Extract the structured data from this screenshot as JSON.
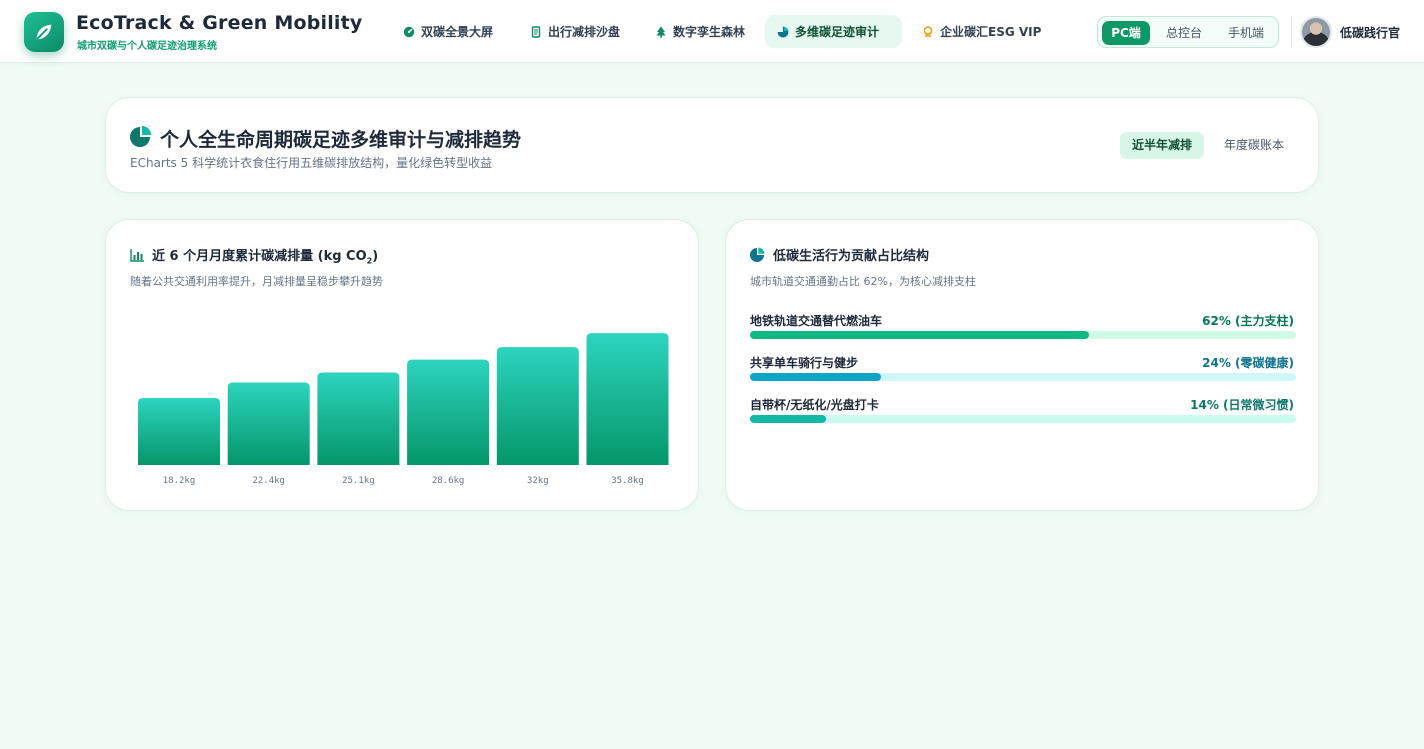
{
  "brand": {
    "title": "EcoTrack & Green Mobility",
    "subtitle": "城市双碳与个人碳足迹治理系统",
    "logo_icon": "leaf-icon"
  },
  "nav": [
    {
      "label": "双碳全景大屏",
      "icon": "dashboard-icon",
      "active": false
    },
    {
      "label": "出行减排沙盘",
      "icon": "document-icon",
      "active": false
    },
    {
      "label": "数字孪生森林",
      "icon": "tree-icon",
      "active": false
    },
    {
      "label": "多维碳足迹审计",
      "icon": "pie-chart-icon",
      "active": true
    },
    {
      "label": "企业碳汇ESG VIP",
      "icon": "medal-icon",
      "active": false
    }
  ],
  "mode_switch": {
    "options": [
      "PC端",
      "总控台",
      "手机端"
    ],
    "selected": "PC端"
  },
  "user": {
    "name": "低碳践行官",
    "avatar": "user-avatar"
  },
  "hero": {
    "title": "个人全生命周期碳足迹多维审计与减排趋势",
    "subtitle": "ECharts 5 科学统计衣食住行用五维碳排放结构，量化绿色转型收益",
    "icon": "pie-chart-icon",
    "tabs": [
      "近半年减排",
      "年度碳账本"
    ],
    "active_tab": "近半年减排"
  },
  "monthly": {
    "title_prefix": "近 6 个月月度累计碳减排量 (kg CO",
    "title_sub": "2",
    "title_suffix": ")",
    "subtitle": "随着公共交通利用率提升，月减排量呈稳步攀升趋势",
    "icon": "bar-chart-icon"
  },
  "chart_data": {
    "type": "bar",
    "categories": [
      "18.2kg",
      "22.4kg",
      "25.1kg",
      "28.6kg",
      "32kg",
      "35.8kg"
    ],
    "values": [
      18.2,
      22.4,
      25.1,
      28.6,
      32,
      35.8
    ],
    "title": "近 6 个月月度累计碳减排量 (kg CO₂)",
    "xlabel": "",
    "ylabel": "",
    "grid": false,
    "colors": {
      "top": "#2dd4bf",
      "bottom": "#059669"
    }
  },
  "mix": {
    "title": "低碳生活行为贡献占比结构",
    "subtitle": "城市轨道交通通勤占比 62%，为核心减排支柱",
    "icon": "pie-chart-icon",
    "rows": [
      {
        "label": "地铁轨道交通替代燃油车",
        "value_text": "62% (主力支柱)",
        "percent": 62,
        "fill": "#10b981",
        "track": "#d1fae5",
        "text_color": "#047857"
      },
      {
        "label": "共享单车骑行与健步",
        "value_text": "24% (零碳健康)",
        "percent": 24,
        "fill": "#0ea5c9",
        "track": "#cff7fa",
        "text_color": "#0e7490"
      },
      {
        "label": "自带杯/无纸化/光盘打卡",
        "value_text": "14% (日常微习惯)",
        "percent": 14,
        "fill": "#14b8a6",
        "track": "#ccfbf1",
        "text_color": "#0f766e"
      }
    ]
  },
  "colors": {
    "accent": "#0e9866",
    "background": "#f1fbf5"
  }
}
